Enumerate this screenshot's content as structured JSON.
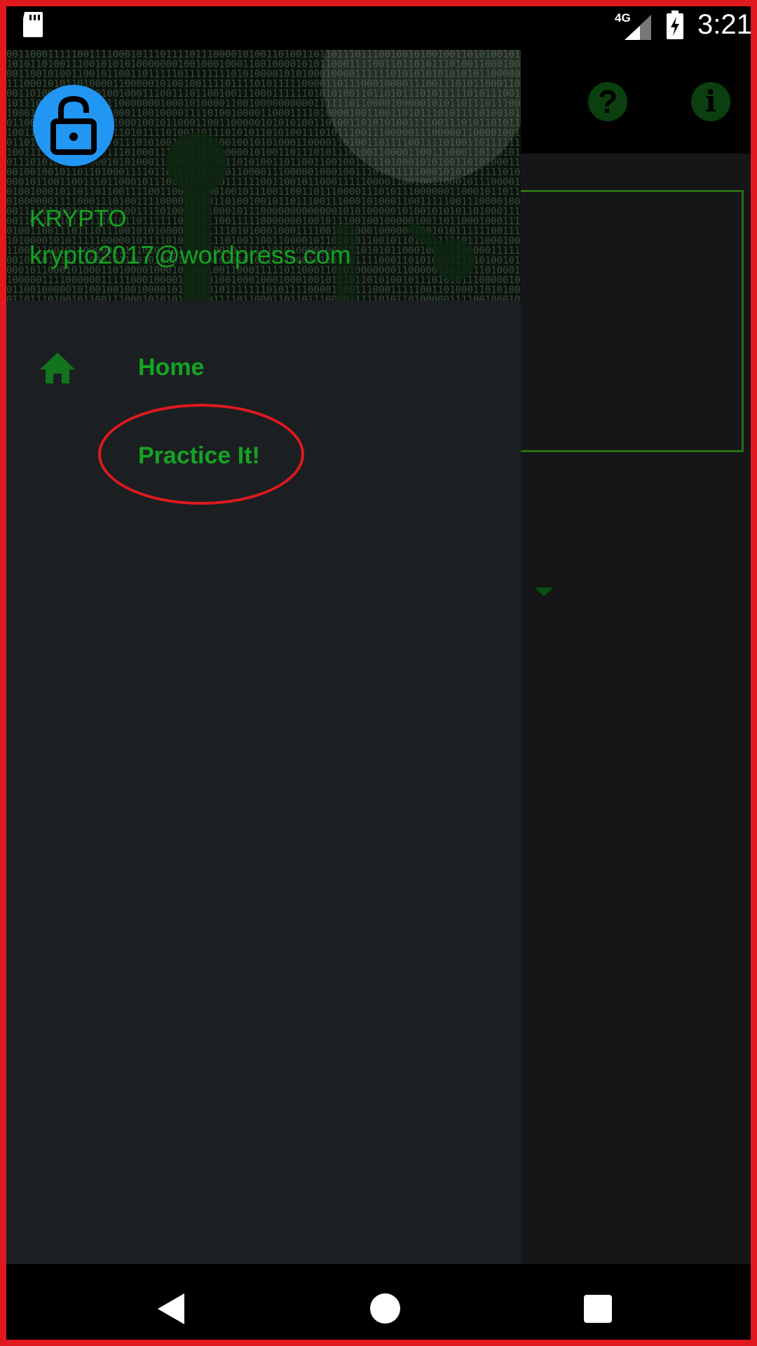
{
  "status_bar": {
    "clock": "3:21",
    "network": "4G",
    "icons": [
      "sd-card-icon",
      "signal-icon",
      "battery-charging-icon"
    ]
  },
  "toolbar": {
    "actions": [
      "help-icon",
      "info-icon"
    ],
    "help_glyph": "?",
    "info_glyph": "i"
  },
  "drawer": {
    "header": {
      "app_name": "KRYPTO",
      "email": "krypto2017@wordpress.com",
      "avatar_icon": "unlocked-padlock-icon"
    },
    "items": [
      {
        "label": "Home",
        "icon": "home-icon"
      },
      {
        "label": "Practice It!",
        "icon": ""
      }
    ]
  },
  "nav_bar": {
    "buttons": [
      "back-icon",
      "home-circle-icon",
      "recents-icon"
    ]
  },
  "colors": {
    "accent_green": "#14a324",
    "avatar_blue": "#2196f3",
    "highlight_red": "#e0191f",
    "drawer_bg": "#1c1f22"
  }
}
